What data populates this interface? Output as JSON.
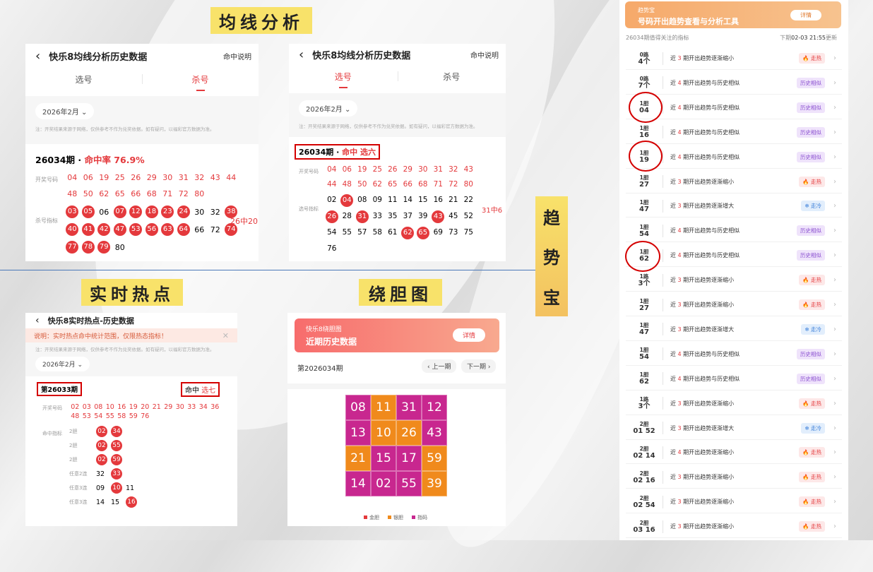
{
  "section_tags": {
    "ma": "均线分析",
    "hot": "实时热点",
    "dan": "绕胆图",
    "trend": [
      "趋",
      "势",
      "宝"
    ]
  },
  "p1": {
    "title": "快乐8均线分析历史数据",
    "help": "命中说明",
    "tab_pick": "选号",
    "tab_kill": "杀号",
    "month": "2026年2月",
    "note": "注：开奖结果来源于网络，仅供参考不作为兑奖依据。如有疑问，以福彩官方数据为准。",
    "period": "26034期 · ",
    "rate": "命中率 76.9%",
    "lbl_draw": "开奖号码",
    "lbl_kill": "杀号指标",
    "draw": [
      "04",
      "06",
      "19",
      "25",
      "26",
      "29",
      "30",
      "31",
      "32",
      "43",
      "44",
      "48",
      "50",
      "62",
      "65",
      "66",
      "68",
      "71",
      "72",
      "80"
    ],
    "kill": [
      "03",
      "05",
      "06",
      "07",
      "12",
      "18",
      "23",
      "24",
      "30",
      "32",
      "38",
      "40",
      "41",
      "42",
      "47",
      "53",
      "56",
      "63",
      "64",
      "66",
      "72",
      "74",
      "77",
      "78",
      "79",
      "80"
    ],
    "kill_hit": [
      true,
      true,
      false,
      true,
      true,
      true,
      true,
      true,
      false,
      false,
      true,
      true,
      true,
      true,
      true,
      true,
      true,
      true,
      true,
      false,
      false,
      true,
      true,
      true,
      true,
      false
    ],
    "summary": "26中20"
  },
  "p2": {
    "title": "快乐8均线分析历史数据",
    "help": "命中说明",
    "tab_pick": "选号",
    "tab_kill": "杀号",
    "month": "2026年2月",
    "note": "注：开奖结果来源于网络，仅供参考不作为兑奖依据。如有疑问，以福彩官方数据为准。",
    "period": "26034期 · ",
    "hit": "命中 选六",
    "lbl_draw": "开奖号码",
    "lbl_pick": "选号指标",
    "draw": [
      "04",
      "06",
      "19",
      "25",
      "26",
      "29",
      "30",
      "31",
      "32",
      "43",
      "44",
      "48",
      "50",
      "62",
      "65",
      "66",
      "68",
      "71",
      "72",
      "80"
    ],
    "pick": [
      "02",
      "04",
      "08",
      "09",
      "11",
      "14",
      "15",
      "16",
      "21",
      "22",
      "26",
      "28",
      "31",
      "33",
      "35",
      "37",
      "39",
      "43",
      "45",
      "52",
      "54",
      "55",
      "57",
      "58",
      "61",
      "62",
      "65",
      "69",
      "73",
      "75",
      "76"
    ],
    "pick_hit": [
      false,
      true,
      false,
      false,
      false,
      false,
      false,
      false,
      false,
      false,
      true,
      false,
      true,
      false,
      false,
      false,
      false,
      true,
      false,
      false,
      false,
      false,
      false,
      false,
      false,
      true,
      true,
      false,
      false,
      false,
      false
    ],
    "summary": "31中6"
  },
  "p3": {
    "title": "快乐8实时热点-历史数据",
    "notice": "说明：实时热点命中统计范围，仅限热态指标！",
    "note": "注：开奖结果来源于网络，仅供参考不作为兑奖依据。如有疑问，以福彩官方数据为准。",
    "month": "2026年2月",
    "period": "第26033期",
    "hit_prefix": "命中 ",
    "hit": "选七",
    "lbl_draw": "开奖号码",
    "lbl_ind": "命中指标",
    "draw": [
      "02",
      "03",
      "08",
      "10",
      "16",
      "19",
      "20",
      "21",
      "29",
      "30",
      "33",
      "34",
      "36",
      "48",
      "53",
      "54",
      "55",
      "58",
      "59",
      "76"
    ],
    "rows": [
      {
        "label": "2胆",
        "nums": [
          "02",
          "34"
        ],
        "hit": [
          true,
          true
        ]
      },
      {
        "label": "2胆",
        "nums": [
          "02",
          "55"
        ],
        "hit": [
          true,
          true
        ]
      },
      {
        "label": "2胆",
        "nums": [
          "02",
          "59"
        ],
        "hit": [
          true,
          true
        ]
      },
      {
        "label": "任意2连",
        "nums": [
          "32",
          "33"
        ],
        "hit": [
          false,
          true
        ]
      },
      {
        "label": "任意3连",
        "nums": [
          "09",
          "10",
          "11"
        ],
        "hit": [
          false,
          true,
          false
        ]
      },
      {
        "label": "任意3连",
        "nums": [
          "14",
          "15",
          "16"
        ],
        "hit": [
          false,
          false,
          true
        ]
      }
    ]
  },
  "p4": {
    "banner_top": "快乐8绕胆图",
    "banner_main": "近期历史数据",
    "detail": "详情",
    "period": "第2026034期",
    "prev": "上一期",
    "next": "下一期",
    "grid": [
      {
        "n": "08",
        "c": "#c8278f"
      },
      {
        "n": "11",
        "c": "#f08a1c"
      },
      {
        "n": "31",
        "c": "#c8278f"
      },
      {
        "n": "12",
        "c": "#c8278f"
      },
      {
        "n": "13",
        "c": "#c8278f"
      },
      {
        "n": "10",
        "c": "#f08a1c"
      },
      {
        "n": "26",
        "c": "#f08a1c"
      },
      {
        "n": "43",
        "c": "#c8278f"
      },
      {
        "n": "21",
        "c": "#f08a1c"
      },
      {
        "n": "15",
        "c": "#c8278f"
      },
      {
        "n": "17",
        "c": "#c8278f"
      },
      {
        "n": "59",
        "c": "#f08a1c"
      },
      {
        "n": "14",
        "c": "#c8278f"
      },
      {
        "n": "02",
        "c": "#c8278f"
      },
      {
        "n": "55",
        "c": "#c8278f"
      },
      {
        "n": "39",
        "c": "#f08a1c"
      }
    ],
    "legend": [
      {
        "label": "金胆",
        "c": "#e4393c"
      },
      {
        "label": "银胆",
        "c": "#f08a1c"
      },
      {
        "label": "指码",
        "c": "#c8278f"
      }
    ]
  },
  "p5": {
    "banner_top": "趋势宝",
    "banner_main": "号码开出趋势查看与分析工具",
    "detail": "详情",
    "header_left": "26034期值得关注的指标",
    "header_right_prefix": "下期",
    "header_right_time": "02-03 21:55",
    "header_right_suffix": "更新",
    "rows": [
      {
        "t": "0路",
        "b": "4个",
        "p": "近 ",
        "k": "3",
        "s": " 期开出趋势逐渐缩小",
        "badge": "走热",
        "type": "hot"
      },
      {
        "t": "0路",
        "b": "7个",
        "p": "近 ",
        "k": "4",
        "s": " 期开出趋势与历史相似",
        "badge": "历史相似",
        "type": "sim"
      },
      {
        "t": "1胆",
        "b": "04",
        "p": "近 ",
        "k": "4",
        "s": " 期开出趋势与历史相似",
        "badge": "历史相似",
        "type": "sim"
      },
      {
        "t": "1胆",
        "b": "16",
        "p": "近 ",
        "k": "4",
        "s": " 期开出趋势与历史相似",
        "badge": "历史相似",
        "type": "sim"
      },
      {
        "t": "1胆",
        "b": "19",
        "p": "近 ",
        "k": "4",
        "s": " 期开出趋势与历史相似",
        "badge": "历史相似",
        "type": "sim"
      },
      {
        "t": "1胆",
        "b": "27",
        "p": "近 ",
        "k": "3",
        "s": " 期开出趋势逐渐缩小",
        "badge": "走热",
        "type": "hot"
      },
      {
        "t": "1胆",
        "b": "47",
        "p": "近 ",
        "k": "3",
        "s": " 期开出趋势逐渐增大",
        "badge": "走冷",
        "type": "cold"
      },
      {
        "t": "1胆",
        "b": "54",
        "p": "近 ",
        "k": "4",
        "s": " 期开出趋势与历史相似",
        "badge": "历史相似",
        "type": "sim"
      },
      {
        "t": "1胆",
        "b": "62",
        "p": "近 ",
        "k": "4",
        "s": " 期开出趋势与历史相似",
        "badge": "历史相似",
        "type": "sim"
      },
      {
        "t": "1路",
        "b": "3个",
        "p": "近 ",
        "k": "3",
        "s": " 期开出趋势逐渐缩小",
        "badge": "走热",
        "type": "hot"
      },
      {
        "t": "1胆",
        "b": "27",
        "p": "近 ",
        "k": "3",
        "s": " 期开出趋势逐渐缩小",
        "badge": "走热",
        "type": "hot"
      },
      {
        "t": "1胆",
        "b": "47",
        "p": "近 ",
        "k": "3",
        "s": " 期开出趋势逐渐增大",
        "badge": "走冷",
        "type": "cold"
      },
      {
        "t": "1胆",
        "b": "54",
        "p": "近 ",
        "k": "4",
        "s": " 期开出趋势与历史相似",
        "badge": "历史相似",
        "type": "sim"
      },
      {
        "t": "1胆",
        "b": "62",
        "p": "近 ",
        "k": "4",
        "s": " 期开出趋势与历史相似",
        "badge": "历史相似",
        "type": "sim"
      },
      {
        "t": "1路",
        "b": "3个",
        "p": "近 ",
        "k": "3",
        "s": " 期开出趋势逐渐缩小",
        "badge": "走热",
        "type": "hot"
      },
      {
        "t": "2胆",
        "b": "01 52",
        "p": "近 ",
        "k": "3",
        "s": " 期开出趋势逐渐增大",
        "badge": "走冷",
        "type": "cold"
      },
      {
        "t": "2胆",
        "b": "02 14",
        "p": "近 ",
        "k": "4",
        "s": " 期开出趋势逐渐缩小",
        "badge": "走热",
        "type": "hot"
      },
      {
        "t": "2胆",
        "b": "02 16",
        "p": "近 ",
        "k": "3",
        "s": " 期开出趋势逐渐缩小",
        "badge": "走热",
        "type": "hot"
      },
      {
        "t": "2胆",
        "b": "02 54",
        "p": "近 ",
        "k": "3",
        "s": " 期开出趋势逐渐缩小",
        "badge": "走热",
        "type": "hot"
      },
      {
        "t": "2胆",
        "b": "03 16",
        "p": "近 ",
        "k": "3",
        "s": " 期开出趋势逐渐缩小",
        "badge": "走热",
        "type": "hot"
      }
    ]
  }
}
